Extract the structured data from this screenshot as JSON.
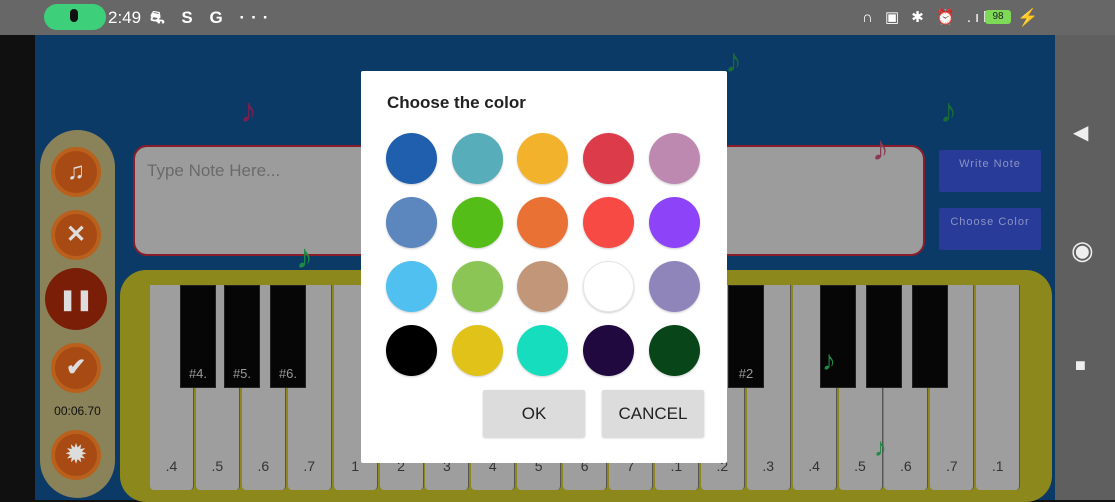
{
  "status_bar": {
    "time": "2:49",
    "left_icons": "⛐ S G ···",
    "right_icons": "∩ ▣ ✱ ⏰ .ıll",
    "battery": "98",
    "charging": "⚡"
  },
  "nav": {
    "back": "◀",
    "home": "◉",
    "recents": "■"
  },
  "sidebar": {
    "buttons": [
      {
        "icon": "music-note-icon",
        "glyph": "♫"
      },
      {
        "icon": "close-icon",
        "glyph": "✕"
      },
      {
        "icon": "pause-icon",
        "glyph": "❚❚"
      },
      {
        "icon": "check-icon",
        "glyph": "✔"
      },
      {
        "icon": "gear-icon",
        "glyph": "✹"
      }
    ],
    "timer": "00:06.70"
  },
  "note_input": {
    "placeholder": "Type Note Here...",
    "value": ""
  },
  "right_buttons": {
    "write_note": "Write Note",
    "choose_color": "Choose Color"
  },
  "piano": {
    "white_keys": [
      ".4",
      ".5",
      ".6",
      ".7",
      "1",
      "2",
      "3",
      "4",
      "5",
      "6",
      "7",
      ".1",
      ".2",
      ".3",
      ".4",
      ".5",
      ".6",
      ".7",
      ".1"
    ],
    "black_keys": [
      "#4.",
      "#5.",
      "#6.",
      "#2",
      "",
      "",
      ""
    ]
  },
  "dialog": {
    "title": "Choose the color",
    "colors": [
      "#1f5fae",
      "#57adb9",
      "#f3b22b",
      "#dc3c49",
      "#be89b0",
      "#5c86be",
      "#55bd17",
      "#e97134",
      "#f74a44",
      "#8d44f8",
      "#4fc0ef",
      "#8bc556",
      "#c29779",
      "#ffffff",
      "#8f85bb",
      "#000000",
      "#e0c218",
      "#16ddbd",
      "#1f093f",
      "#08461a"
    ],
    "ok": "OK",
    "cancel": "CANCEL"
  },
  "colors": {
    "app_bg": "#0c3a66",
    "accent_button": "#293b98"
  }
}
